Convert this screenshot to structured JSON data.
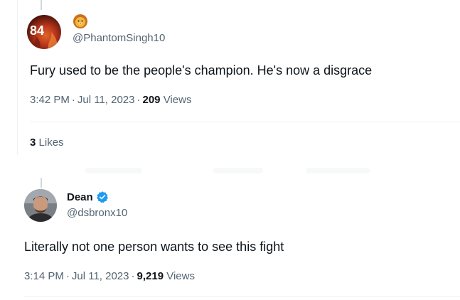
{
  "tweets": [
    {
      "display_name": "",
      "badge_icon": "lion-face-icon",
      "handle": "@PhantomSingh10",
      "text": "Fury used to be the people's champion. He's now a disgrace",
      "time": "3:42 PM",
      "date": "Jul 11, 2023",
      "views_count": "209",
      "views_label": "Views",
      "likes_count": "3",
      "likes_label": "Likes",
      "avatar_text": "84"
    },
    {
      "display_name": "Dean",
      "verified": true,
      "handle": "@dsbronx10",
      "text": "Literally not one person wants to see this fight",
      "time": "3:14 PM",
      "date": "Jul 11, 2023",
      "views_count": "9,219",
      "views_label": "Views"
    }
  ],
  "separator": "·",
  "colors": {
    "primary_text": "#0f1419",
    "secondary_text": "#536471",
    "divider": "#eff3f4",
    "verified_blue": "#1d9bf0"
  }
}
